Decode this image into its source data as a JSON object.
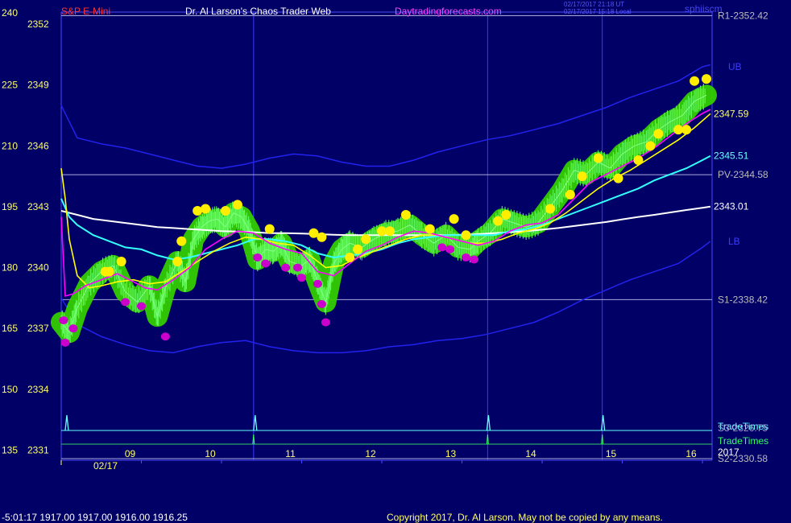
{
  "header": {
    "instrument": "S&P E-Mini",
    "title": "Dr. Al Larson's Chaos Trader Web",
    "site": "Daytradingforecasts.com",
    "time_utc": "02/17/2017 21:18 UT",
    "time_local": "02/17/2017 15:18 Local",
    "tool": "sphiiscm",
    "top_left_label": "240"
  },
  "footer": {
    "quote": "-5:01:17  1917.00 1917.00 1916.00 1916.25",
    "copyright": "Copyright 2017, Dr. Al Larson. May not be copied by any means."
  },
  "colors": {
    "background": "#000066",
    "price": "#33cc33",
    "ema_fast": "#ff00ff",
    "ema_mid": "#ffff00",
    "ema_slow": "#33ffff",
    "ema_long": "#ffffff",
    "bands": "#2222ee",
    "markers": "#33cc00"
  },
  "chart_data": {
    "type": "line",
    "date": "02/17",
    "year": "2017",
    "x_ticks": [
      "09",
      "10",
      "11",
      "12",
      "13",
      "14",
      "15",
      "16"
    ],
    "x_tick_hours": [
      9,
      10,
      11,
      12,
      13,
      14,
      15,
      16
    ],
    "xlim": [
      8.0,
      16.12
    ],
    "ylim": [
      2330.5,
      2352.6
    ],
    "y_ticks": [
      2352,
      2349,
      2346,
      2343,
      2340,
      2337,
      2334,
      2331
    ],
    "osc_ticks": [
      240,
      225,
      210,
      195,
      180,
      165,
      150,
      135
    ],
    "vertical_lines": [
      10.4,
      13.32,
      14.75
    ],
    "levels": [
      {
        "label": "R1-2352.42",
        "value": 2352.42
      },
      {
        "label": "PV-2344.58",
        "value": 2344.58
      },
      {
        "label": "S1-2338.42",
        "value": 2338.42
      },
      {
        "label": "S2-2330.58",
        "value": 2330.58
      }
    ],
    "band_labels": {
      "upper": "UB",
      "lower": "LB"
    },
    "end_labels": {
      "ema_mid": "2347.59",
      "ema_slow": "2345.51",
      "ema_long": "2343.01"
    },
    "lower_labels": [
      "TradeTimes",
      "2017"
    ],
    "overlap_labels": [
      "TradeTimes",
      "S3-2326.75"
    ],
    "timing_pulses": [
      8.07,
      10.42,
      13.33,
      14.76
    ],
    "series": [
      {
        "name": "price",
        "x": [
          8.0,
          8.1,
          8.2,
          8.35,
          8.5,
          8.65,
          8.8,
          8.95,
          9.1,
          9.2,
          9.3,
          9.45,
          9.55,
          9.65,
          9.75,
          9.85,
          9.95,
          10.05,
          10.15,
          10.25,
          10.35,
          10.45,
          10.55,
          10.65,
          10.75,
          10.85,
          11.0,
          11.1,
          11.2,
          11.3,
          11.4,
          11.5,
          11.6,
          11.75,
          11.9,
          12.05,
          12.2,
          12.35,
          12.5,
          12.65,
          12.8,
          12.95,
          13.1,
          13.2,
          13.35,
          13.5,
          13.65,
          13.8,
          13.95,
          14.1,
          14.25,
          14.4,
          14.55,
          14.7,
          14.85,
          15.0,
          15.15,
          15.3,
          15.45,
          15.6,
          15.75,
          15.9,
          16.05
        ],
        "y": [
          2337.3,
          2336.8,
          2338.0,
          2339.2,
          2339.8,
          2340.1,
          2338.8,
          2338.3,
          2339.1,
          2337.6,
          2339.0,
          2340.3,
          2339.3,
          2341.4,
          2342.0,
          2342.3,
          2342.4,
          2342.0,
          2342.7,
          2342.5,
          2341.8,
          2340.4,
          2340.9,
          2340.8,
          2341.2,
          2340.3,
          2340.1,
          2340.4,
          2339.3,
          2338.3,
          2340.2,
          2340.9,
          2341.2,
          2341.0,
          2341.4,
          2341.7,
          2341.8,
          2342.1,
          2341.6,
          2341.2,
          2341.6,
          2341.0,
          2340.9,
          2341.3,
          2341.7,
          2342.4,
          2342.2,
          2342.0,
          2342.2,
          2343.0,
          2343.8,
          2344.8,
          2344.6,
          2345.2,
          2344.9,
          2345.6,
          2346.0,
          2346.2,
          2346.8,
          2347.2,
          2347.5,
          2348.2,
          2348.5
        ]
      },
      {
        "name": "ema_fast",
        "x": [
          8.0,
          8.05,
          8.15,
          8.3,
          8.5,
          8.7,
          8.9,
          9.05,
          9.2,
          9.4,
          9.6,
          9.8,
          10.0,
          10.2,
          10.4,
          10.6,
          10.8,
          11.0,
          11.2,
          11.4,
          11.6,
          11.8,
          12.0,
          12.2,
          12.4,
          12.6,
          12.8,
          13.0,
          13.2,
          13.4,
          13.6,
          13.8,
          14.0,
          14.2,
          14.4,
          14.6,
          14.8,
          15.0,
          15.2,
          15.4,
          15.6,
          15.8,
          16.0,
          16.1
        ],
        "y": [
          2342.5,
          2338.6,
          2338.7,
          2339.1,
          2339.4,
          2339.7,
          2339.3,
          2339.0,
          2338.9,
          2339.4,
          2340.0,
          2340.9,
          2341.4,
          2341.8,
          2341.7,
          2341.2,
          2340.9,
          2340.7,
          2339.8,
          2339.6,
          2340.2,
          2340.8,
          2341.1,
          2341.5,
          2341.8,
          2341.7,
          2341.5,
          2341.3,
          2341.1,
          2341.3,
          2341.8,
          2342.1,
          2342.2,
          2342.6,
          2343.4,
          2344.2,
          2344.6,
          2345.0,
          2345.4,
          2345.9,
          2346.5,
          2347.1,
          2347.6,
          2347.8
        ]
      },
      {
        "name": "ema_mid",
        "x": [
          8.0,
          8.05,
          8.1,
          8.2,
          8.35,
          8.5,
          8.7,
          8.9,
          9.1,
          9.3,
          9.5,
          9.7,
          9.9,
          10.1,
          10.3,
          10.5,
          10.7,
          10.9,
          11.1,
          11.3,
          11.5,
          11.7,
          11.9,
          12.1,
          12.3,
          12.5,
          12.7,
          12.9,
          13.1,
          13.3,
          13.5,
          13.7,
          13.9,
          14.1,
          14.3,
          14.5,
          14.7,
          14.9,
          15.1,
          15.3,
          15.5,
          15.7,
          15.9,
          16.1
        ],
        "y": [
          2344.9,
          2343.4,
          2341.4,
          2339.6,
          2339.0,
          2339.1,
          2339.3,
          2339.4,
          2339.2,
          2339.3,
          2339.8,
          2340.3,
          2340.8,
          2341.2,
          2341.5,
          2341.4,
          2341.2,
          2341.1,
          2340.6,
          2340.0,
          2340.1,
          2340.5,
          2340.8,
          2341.1,
          2341.4,
          2341.6,
          2341.6,
          2341.4,
          2341.2,
          2341.2,
          2341.4,
          2341.7,
          2341.9,
          2342.2,
          2342.7,
          2343.3,
          2343.9,
          2344.4,
          2344.8,
          2345.3,
          2345.8,
          2346.3,
          2346.9,
          2347.59
        ]
      },
      {
        "name": "ema_slow",
        "x": [
          8.0,
          8.1,
          8.2,
          8.4,
          8.6,
          8.8,
          9.0,
          9.2,
          9.4,
          9.6,
          9.8,
          10.0,
          10.2,
          10.4,
          10.6,
          10.8,
          11.0,
          11.2,
          11.4,
          11.6,
          11.8,
          12.0,
          12.2,
          12.4,
          12.6,
          12.8,
          13.0,
          13.2,
          13.4,
          13.6,
          13.8,
          14.0,
          14.2,
          14.4,
          14.6,
          14.8,
          15.0,
          15.2,
          15.4,
          15.6,
          15.8,
          16.0,
          16.1
        ],
        "y": [
          2343.4,
          2342.5,
          2342.1,
          2341.6,
          2341.3,
          2341.0,
          2340.9,
          2340.6,
          2340.4,
          2340.5,
          2340.7,
          2340.9,
          2341.1,
          2341.4,
          2341.4,
          2341.3,
          2341.1,
          2340.7,
          2340.5,
          2340.6,
          2340.7,
          2340.9,
          2341.2,
          2341.4,
          2341.5,
          2341.6,
          2341.6,
          2341.6,
          2341.6,
          2341.8,
          2341.9,
          2342.1,
          2342.4,
          2342.7,
          2343.0,
          2343.3,
          2343.6,
          2343.9,
          2344.3,
          2344.6,
          2344.9,
          2345.3,
          2345.51
        ]
      },
      {
        "name": "ema_long",
        "x": [
          8.0,
          8.2,
          8.4,
          8.6,
          8.8,
          9.0,
          9.2,
          9.4,
          9.6,
          9.8,
          10.0,
          10.2,
          10.4,
          10.6,
          10.8,
          11.0,
          11.2,
          11.4,
          11.6,
          11.8,
          12.0,
          12.2,
          12.4,
          12.6,
          12.8,
          13.0,
          13.2,
          13.4,
          13.6,
          13.8,
          14.0,
          14.2,
          14.4,
          14.6,
          14.8,
          15.0,
          15.2,
          15.4,
          15.6,
          15.8,
          16.0,
          16.1
        ],
        "y": [
          2342.8,
          2342.6,
          2342.4,
          2342.3,
          2342.2,
          2342.1,
          2342.0,
          2341.95,
          2341.9,
          2341.85,
          2341.8,
          2341.78,
          2341.75,
          2341.7,
          2341.7,
          2341.68,
          2341.65,
          2341.62,
          2341.6,
          2341.6,
          2341.6,
          2341.6,
          2341.6,
          2341.6,
          2341.6,
          2341.62,
          2341.65,
          2341.7,
          2341.75,
          2341.8,
          2341.87,
          2341.95,
          2342.05,
          2342.15,
          2342.25,
          2342.38,
          2342.5,
          2342.6,
          2342.72,
          2342.84,
          2342.95,
          2343.01
        ]
      },
      {
        "name": "upper_band",
        "x": [
          8.0,
          8.2,
          8.5,
          8.8,
          9.1,
          9.4,
          9.7,
          10.0,
          10.3,
          10.6,
          10.9,
          11.2,
          11.5,
          11.8,
          12.1,
          12.4,
          12.7,
          13.0,
          13.3,
          13.6,
          13.9,
          14.2,
          14.5,
          14.8,
          15.1,
          15.4,
          15.7,
          16.0,
          16.1
        ],
        "y": [
          2348.0,
          2346.4,
          2346.1,
          2345.9,
          2345.6,
          2345.3,
          2345.0,
          2344.9,
          2345.1,
          2345.4,
          2345.6,
          2345.5,
          2345.2,
          2345.0,
          2345.0,
          2345.3,
          2345.7,
          2346.0,
          2346.3,
          2346.5,
          2346.8,
          2347.1,
          2347.5,
          2347.9,
          2348.4,
          2348.8,
          2349.2,
          2349.9,
          2350.0
        ]
      },
      {
        "name": "lower_band",
        "x": [
          8.0,
          8.2,
          8.5,
          8.8,
          9.1,
          9.4,
          9.7,
          10.0,
          10.3,
          10.6,
          10.9,
          11.2,
          11.5,
          11.8,
          12.1,
          12.4,
          12.7,
          13.0,
          13.3,
          13.6,
          13.9,
          14.2,
          14.5,
          14.8,
          15.1,
          15.4,
          15.7,
          16.0,
          16.1
        ],
        "y": [
          2338.5,
          2337.2,
          2336.6,
          2336.2,
          2335.9,
          2335.8,
          2336.1,
          2336.3,
          2336.4,
          2336.1,
          2335.9,
          2335.8,
          2335.8,
          2335.9,
          2336.1,
          2336.2,
          2336.4,
          2336.5,
          2336.7,
          2337.0,
          2337.3,
          2337.8,
          2338.4,
          2338.9,
          2339.4,
          2339.8,
          2340.2,
          2341.0,
          2341.3
        ]
      }
    ],
    "yellow_markers": [
      {
        "x": 8.55,
        "y": 2339.8
      },
      {
        "x": 8.6,
        "y": 2339.8
      },
      {
        "x": 8.75,
        "y": 2340.3
      },
      {
        "x": 9.45,
        "y": 2340.3
      },
      {
        "x": 9.5,
        "y": 2341.3
      },
      {
        "x": 9.7,
        "y": 2342.8
      },
      {
        "x": 9.8,
        "y": 2342.9
      },
      {
        "x": 10.05,
        "y": 2342.8
      },
      {
        "x": 10.2,
        "y": 2343.1
      },
      {
        "x": 10.6,
        "y": 2341.9
      },
      {
        "x": 11.15,
        "y": 2341.7
      },
      {
        "x": 11.25,
        "y": 2341.5
      },
      {
        "x": 11.6,
        "y": 2340.5
      },
      {
        "x": 11.7,
        "y": 2340.9
      },
      {
        "x": 11.8,
        "y": 2341.4
      },
      {
        "x": 12.0,
        "y": 2341.8
      },
      {
        "x": 12.1,
        "y": 2341.8
      },
      {
        "x": 12.3,
        "y": 2342.6
      },
      {
        "x": 12.6,
        "y": 2341.9
      },
      {
        "x": 12.9,
        "y": 2342.4
      },
      {
        "x": 13.05,
        "y": 2341.6
      },
      {
        "x": 13.45,
        "y": 2342.3
      },
      {
        "x": 13.55,
        "y": 2342.6
      },
      {
        "x": 14.1,
        "y": 2342.9
      },
      {
        "x": 14.35,
        "y": 2343.6
      },
      {
        "x": 14.5,
        "y": 2344.5
      },
      {
        "x": 14.7,
        "y": 2345.4
      },
      {
        "x": 14.95,
        "y": 2344.4
      },
      {
        "x": 15.2,
        "y": 2345.3
      },
      {
        "x": 15.35,
        "y": 2346.0
      },
      {
        "x": 15.45,
        "y": 2346.6
      },
      {
        "x": 15.7,
        "y": 2346.8
      },
      {
        "x": 15.8,
        "y": 2346.8
      },
      {
        "x": 15.9,
        "y": 2349.2
      },
      {
        "x": 16.05,
        "y": 2349.3
      }
    ],
    "magenta_markers": [
      {
        "x": 8.03,
        "y": 2337.4
      },
      {
        "x": 8.05,
        "y": 2336.3
      },
      {
        "x": 8.15,
        "y": 2337.0
      },
      {
        "x": 8.8,
        "y": 2338.3
      },
      {
        "x": 9.0,
        "y": 2338.1
      },
      {
        "x": 9.3,
        "y": 2336.6
      },
      {
        "x": 10.45,
        "y": 2340.5
      },
      {
        "x": 10.55,
        "y": 2340.2
      },
      {
        "x": 10.8,
        "y": 2340.0
      },
      {
        "x": 10.95,
        "y": 2340.0
      },
      {
        "x": 11.0,
        "y": 2339.5
      },
      {
        "x": 11.2,
        "y": 2339.2
      },
      {
        "x": 11.25,
        "y": 2338.2
      },
      {
        "x": 11.3,
        "y": 2337.3
      },
      {
        "x": 12.75,
        "y": 2341.0
      },
      {
        "x": 12.85,
        "y": 2340.9
      },
      {
        "x": 13.05,
        "y": 2340.5
      },
      {
        "x": 13.15,
        "y": 2340.4
      }
    ]
  }
}
